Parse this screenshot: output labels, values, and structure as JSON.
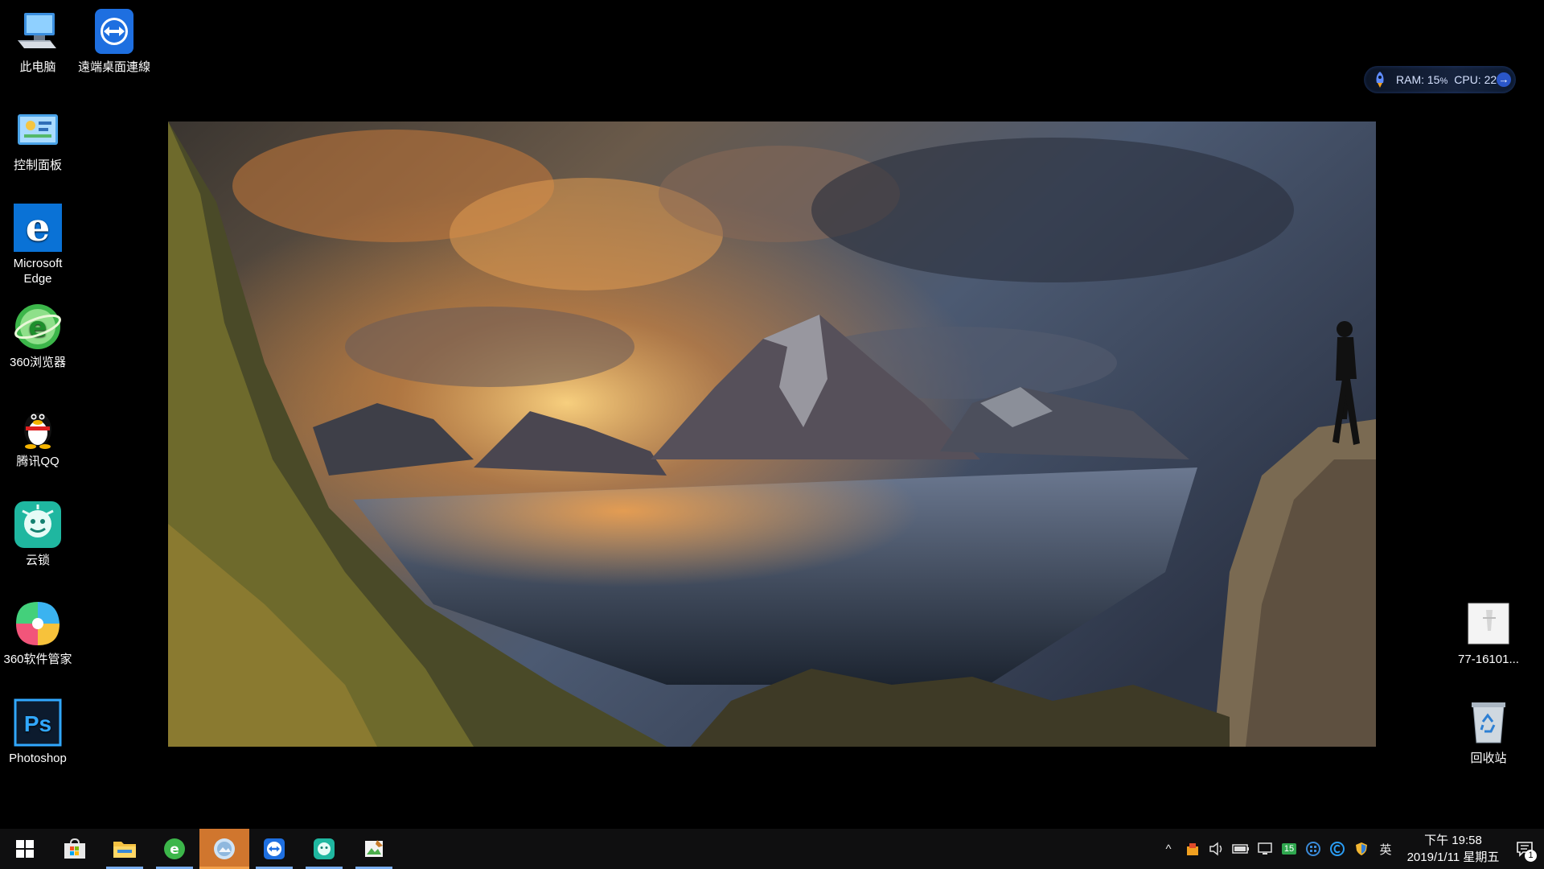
{
  "desktop": {
    "icons_left": [
      {
        "label": "此电脑",
        "icon": "this-pc-icon"
      },
      {
        "label": "遠端桌面連線",
        "icon": "teamviewer-icon"
      },
      {
        "label": "控制面板",
        "icon": "control-panel-icon"
      },
      {
        "label": "Microsoft Edge",
        "icon": "edge-icon"
      },
      {
        "label": "360浏览器",
        "icon": "360-browser-icon"
      },
      {
        "label": "腾讯QQ",
        "icon": "qq-penguin-icon"
      },
      {
        "label": "云锁",
        "icon": "yunsuo-icon"
      },
      {
        "label": "360软件管家",
        "icon": "360-software-manager-icon"
      },
      {
        "label": "Photoshop",
        "icon": "photoshop-icon"
      }
    ],
    "icons_right": [
      {
        "label": "77-16101...",
        "icon": "image-file-icon"
      },
      {
        "label": "回收站",
        "icon": "recycle-bin-icon"
      }
    ]
  },
  "resource_monitor": {
    "ram_label": "RAM: 15",
    "cpu_label": "CPU: 22",
    "percent": "%",
    "arrow": "→"
  },
  "wallpaper": {
    "description_icon": "mountain-lake-photo"
  },
  "taskbar": {
    "pinned": [
      {
        "icon": "windows-start-icon"
      },
      {
        "icon": "microsoft-store-icon"
      },
      {
        "icon": "file-explorer-icon"
      },
      {
        "icon": "360-browser-icon"
      },
      {
        "icon": "photo-viewer-icon"
      },
      {
        "icon": "teamviewer-icon"
      },
      {
        "icon": "yunsuo-icon"
      },
      {
        "icon": "image-editor-icon"
      }
    ],
    "tray": {
      "chevron": "^",
      "ime": "英",
      "badge_15": "15"
    },
    "clock": {
      "time": "下午 19:58",
      "date": "2019/1/11 星期五"
    },
    "notification_count": "1"
  },
  "colors": {
    "taskbar_bg": "#0f0f10",
    "active_task": "#d0762e",
    "running_indicator": "#7aaef0",
    "accent_blue": "#2a56c8"
  }
}
